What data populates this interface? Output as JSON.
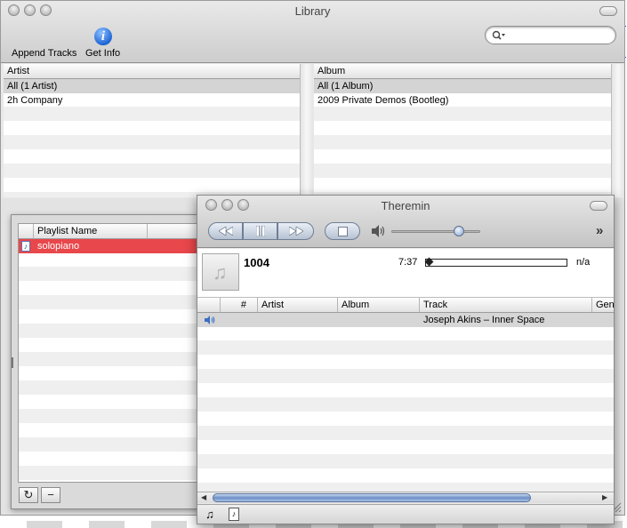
{
  "library": {
    "title": "Library",
    "toolbar": {
      "append_label": "Append Tracks",
      "info_label": "Get Info"
    },
    "search": {
      "placeholder": ""
    },
    "artist_header": "Artist",
    "album_header": "Album",
    "artists": [
      "All (1 Artist)",
      "2h Company"
    ],
    "albums": [
      "All (1 Album)",
      "2009 Private Demos (Bootleg)"
    ]
  },
  "playlists": {
    "header": "Playlist Name",
    "items": [
      "solopiano"
    ],
    "selected_color": "#e8474b"
  },
  "player": {
    "title": "Theremin",
    "now_playing": {
      "track_number": "1004",
      "time": "7:37",
      "remaining": "n/a",
      "progress": 0.0
    },
    "volume": 0.8,
    "columns": [
      "#",
      "Artist",
      "Album",
      "Track",
      "Gen"
    ],
    "tracks": [
      {
        "number": "",
        "artist": "",
        "album": "",
        "track": "Joseph Akins – Inner Space",
        "playing": true
      }
    ]
  }
}
